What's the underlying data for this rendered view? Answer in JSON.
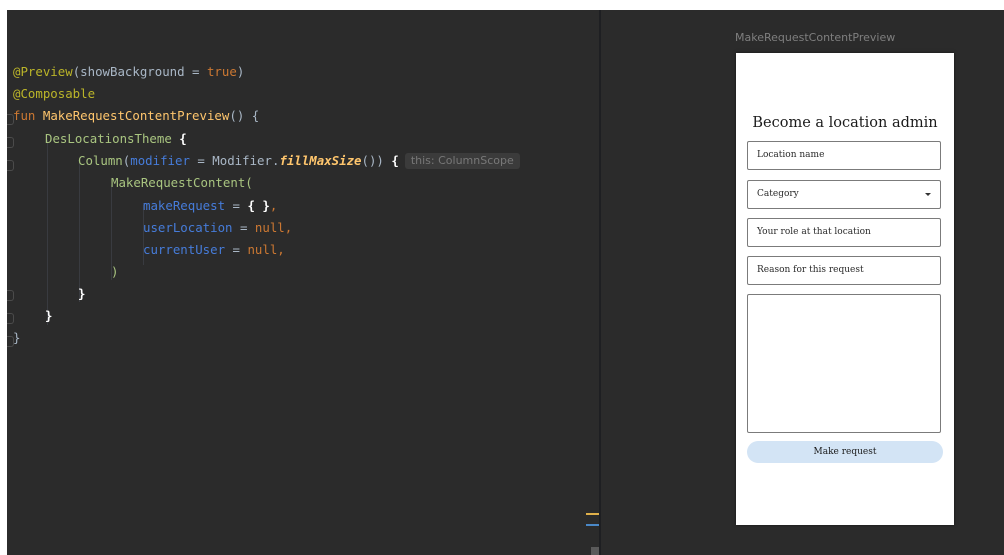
{
  "code": {
    "line1": {
      "annotation": "@Preview",
      "args": "(showBackground = ",
      "value": "true",
      "close": ")"
    },
    "line2": {
      "annotation": "@Composable"
    },
    "line3": {
      "keyword": "fun",
      "function": "MakeRequestContentPreview",
      "rest": "() {"
    },
    "line4": {
      "theme": "DesLocationsTheme",
      "brace": " {"
    },
    "line5": {
      "column": "Column",
      "paren": "(",
      "param": "modifier",
      "eq": " = Modifier.",
      "fn": "fillMaxSize",
      "rest": "()) ",
      "brace": "{",
      "hint": "this: ColumnScope"
    },
    "line6": {
      "text": "MakeRequestContent("
    },
    "line7": {
      "param": "makeRequest",
      "eq": " = ",
      "braces": "{ }",
      "comma": ","
    },
    "line8": {
      "param": "userLocation",
      "eq": " = ",
      "value": "null",
      "comma": ","
    },
    "line9": {
      "param": "currentUser",
      "eq": " = ",
      "value": "null",
      "comma": ","
    },
    "line10": {
      "text": ")"
    },
    "line11": {
      "text": "}"
    },
    "line12": {
      "text": "}"
    },
    "line13": {
      "text": "}"
    }
  },
  "preview": {
    "label": "MakeRequestContentPreview",
    "title": "Become a location admin",
    "fields": {
      "location_name": "Location name",
      "category": "Category",
      "role": "Your role at that location",
      "reason": "Reason for this request"
    },
    "button": "Make request"
  },
  "colors": {
    "editor_bg": "#2b2b2b",
    "annotation": "#bbb529",
    "keyword": "#cc7832",
    "function": "#ffc66d",
    "parameter": "#467cda",
    "theme_call": "#a9c580",
    "button_bg": "#d3e4f5"
  },
  "icons": {
    "dropdown": "caret-down-icon",
    "fold": "fold-marker-icon"
  }
}
